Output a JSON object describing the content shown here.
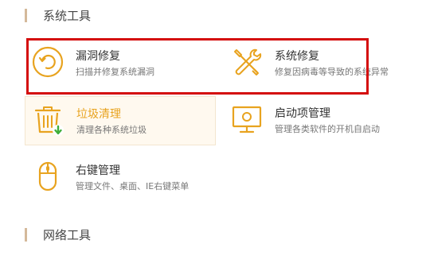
{
  "sections": {
    "system_tools": "系统工具",
    "network_tools": "网络工具"
  },
  "tools": {
    "leak_repair": {
      "name": "漏洞修复",
      "desc": "扫描并修复系统漏洞",
      "icon": "target-ring-icon"
    },
    "system_repair": {
      "name": "系统修复",
      "desc": "修复因病毒等导致的系统异常",
      "icon": "wrench-screwdriver-icon"
    },
    "junk_clean": {
      "name": "垃圾清理",
      "desc": "清理各种系统垃圾",
      "icon": "trash-can-icon"
    },
    "startup_manager": {
      "name": "启动项管理",
      "desc": "管理各类软件的开机自启动",
      "icon": "monitor-icon"
    },
    "context_menu": {
      "name": "右键管理",
      "desc": "管理文件、桌面、IE右键菜单",
      "icon": "mouse-icon"
    }
  },
  "colors": {
    "accent": "#e8a31f",
    "highlight_border": "#d40d0d",
    "section_bar": "#d4b99a"
  }
}
